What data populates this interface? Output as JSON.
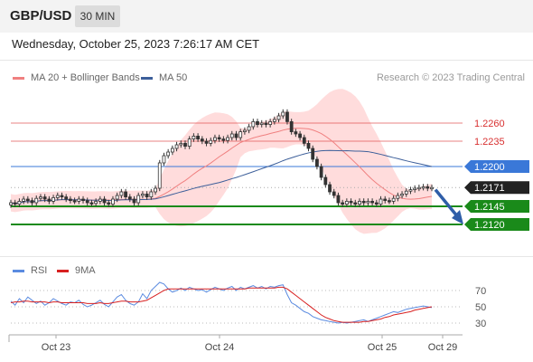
{
  "header": {
    "symbol": "GBP/USD",
    "timeframe": "30 MIN"
  },
  "timestamp": "Wednesday, October 25, 2023 7:26:17 AM CET",
  "legend": {
    "bollinger": "MA 20 + Bollinger Bands",
    "ma50": "MA 50",
    "credit": "Research © 2023 Trading Central"
  },
  "rsi_legend": {
    "rsi": "RSI",
    "ma": "9MA"
  },
  "colors": {
    "resistance": "#e05050",
    "pivot": "#3a78d8",
    "support": "#1a8a1a",
    "bollinger_fill": "#ffd6d6",
    "ma50": "#3d5f9a",
    "rsi": "#5b8be0",
    "rsi_ma": "#d82020",
    "arrow": "#2f5ea8"
  },
  "chart_data": [
    {
      "type": "candlestick",
      "title": "",
      "x_labels": [
        "Oct 23",
        "Oct 24",
        "Oct 25",
        "Oct 29"
      ],
      "ylim": [
        1.209,
        1.231
      ],
      "last_price": 1.2171,
      "levels": [
        {
          "value": 1.226,
          "label": "1.2260",
          "kind": "resistance"
        },
        {
          "value": 1.2235,
          "label": "1.2235",
          "kind": "resistance"
        },
        {
          "value": 1.22,
          "label": "1.2200",
          "kind": "pivot"
        },
        {
          "value": 1.2171,
          "label": "1.2171",
          "kind": "last"
        },
        {
          "value": 1.2145,
          "label": "1.2145",
          "kind": "support"
        },
        {
          "value": 1.212,
          "label": "1.2120",
          "kind": "support"
        }
      ],
      "close": [
        1.215,
        1.2148,
        1.2152,
        1.2155,
        1.2153,
        1.215,
        1.2156,
        1.2158,
        1.2155,
        1.2152,
        1.2157,
        1.216,
        1.2158,
        1.2155,
        1.2153,
        1.2152,
        1.2155,
        1.2153,
        1.215,
        1.2149,
        1.2152,
        1.2155,
        1.215,
        1.2148,
        1.2155,
        1.216,
        1.2165,
        1.2158,
        1.2155,
        1.215,
        1.216,
        1.2162,
        1.2158,
        1.2165,
        1.217,
        1.2205,
        1.2215,
        1.222,
        1.2225,
        1.223,
        1.2232,
        1.2228,
        1.2238,
        1.2242,
        1.2238,
        1.2235,
        1.2232,
        1.2236,
        1.224,
        1.2238,
        1.2236,
        1.224,
        1.2245,
        1.224,
        1.2248,
        1.225,
        1.2255,
        1.2262,
        1.2258,
        1.226,
        1.2258,
        1.2262,
        1.2265,
        1.227,
        1.2275,
        1.2262,
        1.2248,
        1.2245,
        1.224,
        1.2232,
        1.2225,
        1.221,
        1.22,
        1.2185,
        1.2175,
        1.2165,
        1.216,
        1.215,
        1.2148,
        1.2152,
        1.215,
        1.2148,
        1.2152,
        1.215,
        1.2152,
        1.215,
        1.2148,
        1.2155,
        1.2153,
        1.2152,
        1.2156,
        1.216,
        1.2162,
        1.2166,
        1.2168,
        1.217,
        1.2171,
        1.2172,
        1.217,
        1.2171
      ],
      "forecast_arrow": {
        "from": 1.2168,
        "to": 1.212
      }
    },
    {
      "type": "line",
      "title": "",
      "ylim": [
        20,
        80
      ],
      "y_ticks": [
        70,
        50,
        30
      ],
      "series": [
        {
          "name": "RSI",
          "values": [
            57,
            52,
            60,
            55,
            62,
            58,
            54,
            57,
            52,
            55,
            60,
            57,
            54,
            52,
            56,
            55,
            58,
            53,
            50,
            52,
            55,
            58,
            53,
            50,
            56,
            62,
            65,
            58,
            54,
            52,
            56,
            66,
            60,
            70,
            75,
            80,
            78,
            72,
            68,
            70,
            73,
            70,
            74,
            72,
            70,
            71,
            68,
            71,
            74,
            72,
            70,
            73,
            75,
            70,
            74,
            72,
            74,
            76,
            73,
            75,
            72,
            75,
            74,
            76,
            77,
            65,
            55,
            52,
            48,
            44,
            42,
            38,
            36,
            34,
            33,
            32,
            31,
            30,
            31,
            30,
            31,
            32,
            33,
            34,
            32,
            34,
            36,
            38,
            40,
            42,
            44,
            43,
            45,
            47,
            48,
            49,
            50,
            51,
            50,
            49
          ]
        },
        {
          "name": "9MA",
          "values": [
            55,
            56,
            56,
            57,
            57,
            56,
            56,
            56,
            56,
            55,
            56,
            56,
            55,
            55,
            55,
            55,
            55,
            55,
            54,
            54,
            54,
            55,
            54,
            54,
            55,
            56,
            57,
            57,
            56,
            56,
            56,
            57,
            58,
            61,
            64,
            67,
            70,
            72,
            72,
            72,
            72,
            72,
            72,
            72,
            72,
            72,
            72,
            72,
            72,
            72,
            72,
            72,
            72,
            72,
            72,
            72,
            73,
            73,
            73,
            73,
            73,
            73,
            73,
            74,
            74,
            72,
            68,
            64,
            60,
            56,
            52,
            48,
            44,
            40,
            37,
            35,
            33,
            32,
            31,
            31,
            31,
            31,
            31,
            32,
            32,
            33,
            34,
            35,
            37,
            38,
            40,
            41,
            42,
            43,
            44,
            46,
            47,
            48,
            49,
            50
          ]
        }
      ]
    }
  ]
}
